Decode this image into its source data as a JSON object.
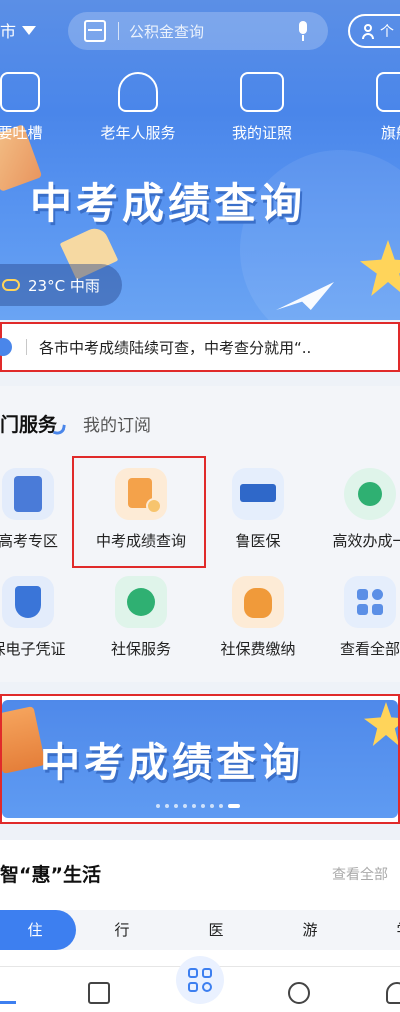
{
  "header": {
    "city": "市",
    "search_placeholder": "公积金查询",
    "login_label": "个"
  },
  "quick_links": [
    {
      "label": "要吐槽",
      "icon": "speech-icon"
    },
    {
      "label": "老年人服务",
      "icon": "heart-hand-icon"
    },
    {
      "label": "我的证照",
      "icon": "id-card-icon"
    },
    {
      "label": "旗舰",
      "icon": "store-icon"
    }
  ],
  "hero_banner": {
    "title": "中考成绩查询",
    "weather": "23°C 中雨"
  },
  "notice": {
    "text": "各市中考成绩陆续可查，中考查分就用“.."
  },
  "services": {
    "tab_active": "门服务",
    "tab_other": "我的订阅",
    "items": [
      {
        "label": "高考专区",
        "icon": "exam-book-icon",
        "color": "#4a7bd8"
      },
      {
        "label": "中考成绩查询",
        "icon": "score-book-icon",
        "color": "#f4a24a"
      },
      {
        "label": "鲁医保",
        "icon": "chs-medical-icon",
        "color": "#2f68c9"
      },
      {
        "label": "高效办成一",
        "icon": "efficient-service-icon",
        "color": "#2fb072"
      },
      {
        "label": "保电子凭证",
        "icon": "chs-shield-icon",
        "color": "#3a75d8"
      },
      {
        "label": "社保服务",
        "icon": "social-security-icon",
        "color": "#2fb072"
      },
      {
        "label": "社保费缴纳",
        "icon": "money-bag-icon",
        "color": "#f09a3a"
      },
      {
        "label": "查看全部",
        "icon": "grid-apps-icon",
        "color": "#5b8fe6"
      }
    ]
  },
  "promo_banner": {
    "title": "中考成绩查询"
  },
  "life": {
    "title": "智“惠”生活",
    "view_all": "查看全部",
    "categories": [
      "住",
      "行",
      "医",
      "游",
      "学"
    ]
  },
  "colors": {
    "accent": "#3d7ff0",
    "highlight_border": "#e02a2a"
  }
}
